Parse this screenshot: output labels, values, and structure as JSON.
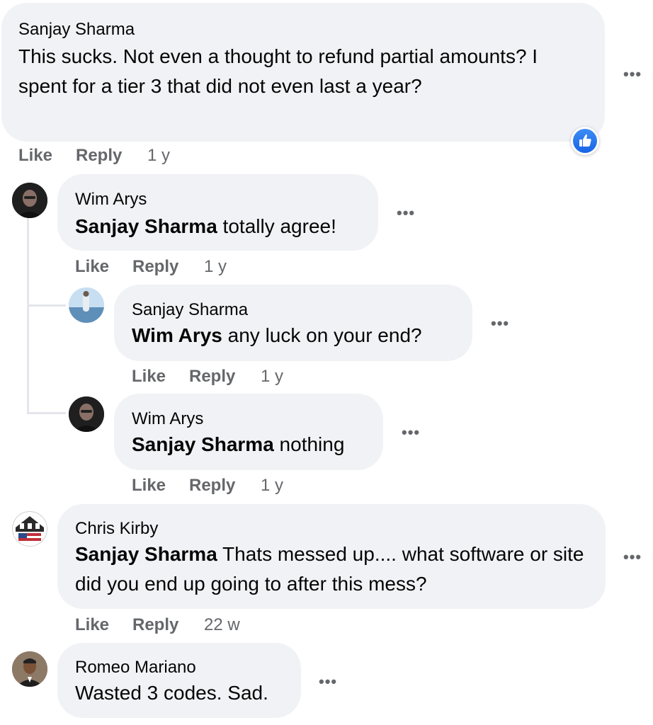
{
  "comments": [
    {
      "author": "Sanjay Sharma",
      "text": "This sucks. Not even a thought to refund partial amounts? I spent for a tier 3 that did not even last a year?",
      "actions": {
        "like": "Like",
        "reply": "Reply",
        "time": "1 y"
      },
      "more": "•••",
      "reaction_icon": "thumbs-up-icon"
    },
    {
      "author": "Wim Arys",
      "mention": "Sanjay Sharma",
      "text": " totally agree!",
      "actions": {
        "like": "Like",
        "reply": "Reply",
        "time": "1 y"
      },
      "more": "•••"
    },
    {
      "author": "Sanjay Sharma",
      "mention": "Wim Arys",
      "text": " any luck on your end?",
      "actions": {
        "like": "Like",
        "reply": "Reply",
        "time": "1 y"
      },
      "more": "•••"
    },
    {
      "author": "Wim Arys",
      "mention": "Sanjay Sharma",
      "text": " nothing",
      "actions": {
        "like": "Like",
        "reply": "Reply",
        "time": "1 y"
      },
      "more": "•••"
    },
    {
      "author": "Chris Kirby",
      "mention": "Sanjay Sharma",
      "text": " Thats messed up.... what software or site did you end up going to after this mess?",
      "actions": {
        "like": "Like",
        "reply": "Reply",
        "time": "22 w"
      },
      "more": "•••"
    },
    {
      "author": "Romeo Mariano",
      "text": "Wasted 3 codes. Sad.",
      "more": "•••"
    }
  ],
  "colors": {
    "bubble": "#f0f2f5",
    "meta": "#65676b",
    "like_blue": "#1877f2"
  }
}
